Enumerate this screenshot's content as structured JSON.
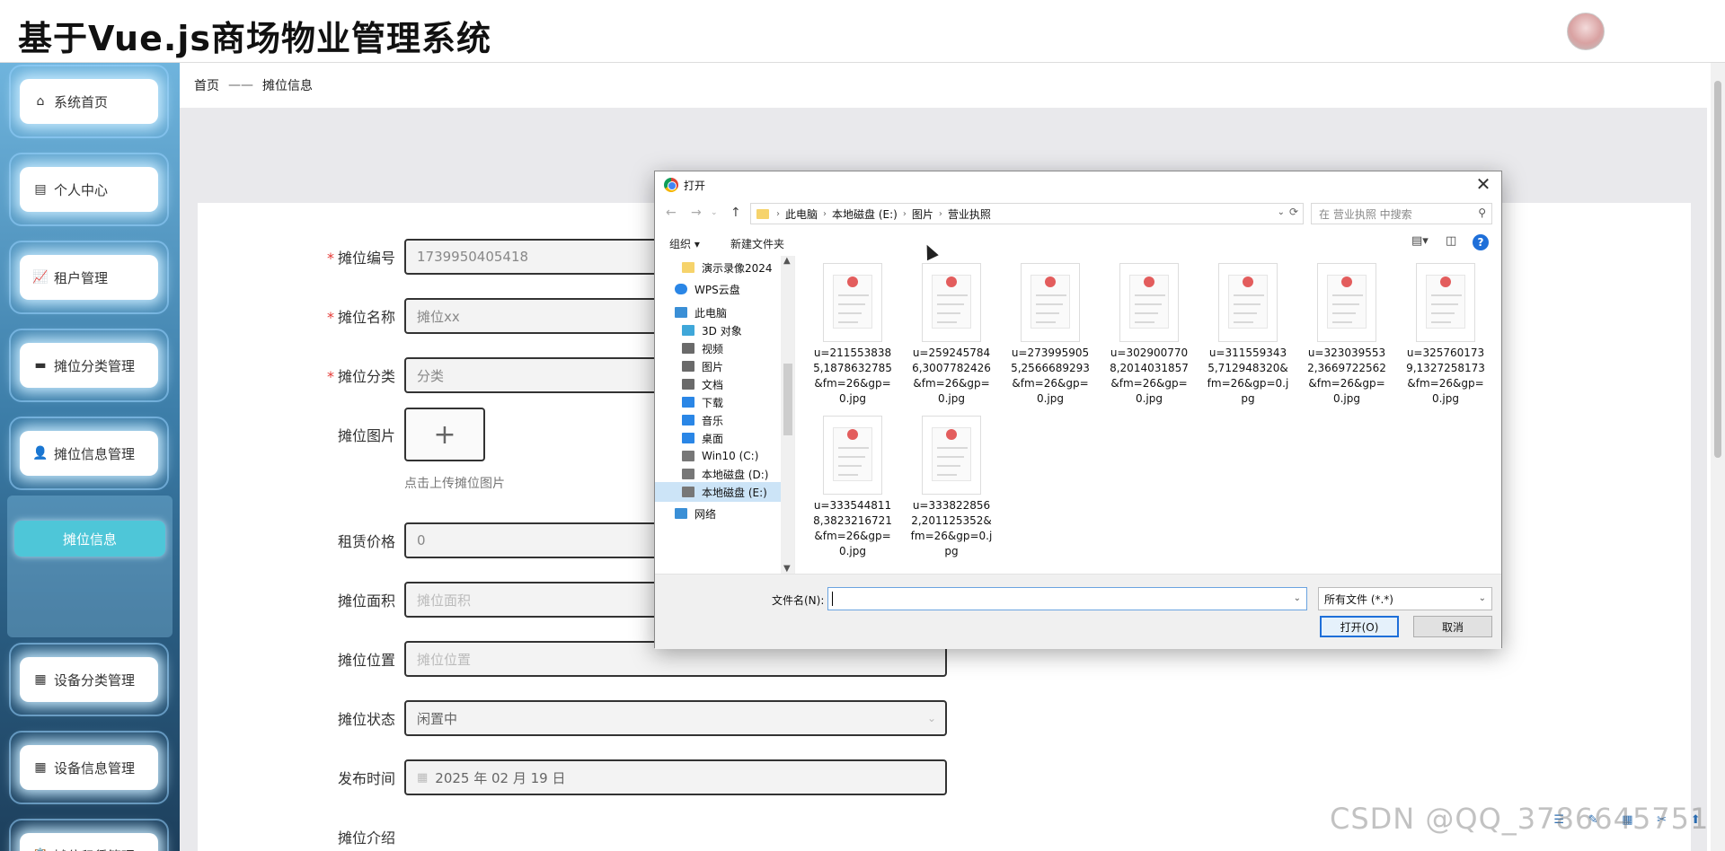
{
  "app": {
    "title": "基于Vue.js商场物业管理系统"
  },
  "sidebar": {
    "items": [
      {
        "icon": "home-icon",
        "glyph": "⌂",
        "label": "系统首页"
      },
      {
        "icon": "id-card-icon",
        "glyph": "▤",
        "label": "个人中心"
      },
      {
        "icon": "chart-icon",
        "glyph": "📈",
        "label": "租户管理"
      },
      {
        "icon": "printer-icon",
        "glyph": "▬",
        "label": "摊位分类管理"
      },
      {
        "icon": "user-icon",
        "glyph": "👤",
        "label": "摊位信息管理"
      },
      {
        "icon": "grid-icon",
        "glyph": "▦",
        "label": "设备分类管理"
      },
      {
        "icon": "grid-icon",
        "glyph": "▦",
        "label": "设备信息管理"
      },
      {
        "icon": "clipboard-icon",
        "glyph": "📋",
        "label": "摊位租赁管理"
      }
    ],
    "active_sub": "摊位信息"
  },
  "breadcrumb": {
    "home": "首页",
    "separator": "——",
    "current": "摊位信息"
  },
  "form": {
    "stall_no": {
      "label": "摊位编号",
      "value": "1739950405418",
      "required": true
    },
    "stall_name": {
      "label": "摊位名称",
      "value": "摊位xx",
      "required": true
    },
    "stall_category": {
      "label": "摊位分类",
      "value": "分类",
      "required": true
    },
    "stall_image": {
      "label": "摊位图片",
      "upload_glyph": "+",
      "hint": "点击上传摊位图片"
    },
    "rent_price": {
      "label": "租赁价格",
      "value": "0"
    },
    "stall_area": {
      "label": "摊位面积",
      "placeholder": "摊位面积"
    },
    "stall_location": {
      "label": "摊位位置",
      "placeholder": "摊位位置"
    },
    "stall_status": {
      "label": "摊位状态",
      "value": "闲置中"
    },
    "publish_time": {
      "label": "发布时间",
      "value": "2025 年 02 月 19 日"
    },
    "stall_intro": {
      "label": "摊位介绍"
    }
  },
  "dialog": {
    "title": "打开",
    "path": [
      "此电脑",
      "本地磁盘 (E:)",
      "图片",
      "营业执照"
    ],
    "search_placeholder": "在 营业执照 中搜索",
    "toolbar": {
      "organize": "组织 ▾",
      "new_folder": "新建文件夹"
    },
    "tree": [
      {
        "label": "演示录像2024",
        "icon": "folder"
      },
      {
        "label": "WPS云盘",
        "icon": "cloud"
      },
      {
        "label": "此电脑",
        "icon": "pc"
      },
      {
        "label": "3D 对象",
        "icon": "cube"
      },
      {
        "label": "视频",
        "icon": "video"
      },
      {
        "label": "图片",
        "icon": "picture"
      },
      {
        "label": "文档",
        "icon": "doc"
      },
      {
        "label": "下载",
        "icon": "download"
      },
      {
        "label": "音乐",
        "icon": "music"
      },
      {
        "label": "桌面",
        "icon": "desktop"
      },
      {
        "label": "Win10 (C:)",
        "icon": "drive"
      },
      {
        "label": "本地磁盘 (D:)",
        "icon": "drive"
      },
      {
        "label": "本地磁盘 (E:)",
        "icon": "drive",
        "selected": true
      },
      {
        "label": "网络",
        "icon": "network"
      }
    ],
    "files": [
      "u=2115538385,1878632785&fm=26&gp=0.jpg",
      "u=2592457846,3007782426&fm=26&gp=0.jpg",
      "u=2739959055,2566689293&fm=26&gp=0.jpg",
      "u=3029007708,2014031857&fm=26&gp=0.jpg",
      "u=3115593435,712948320&fm=26&gp=0.jpg",
      "u=3230395532,3669722562&fm=26&gp=0.jpg",
      "u=3257601739,1327258173&fm=26&gp=0.jpg",
      "u=3335448118,3823216721&fm=26&gp=0.jpg",
      "u=3338228562,201125352&fm=26&gp=0.jpg"
    ],
    "filename_label": "文件名(N):",
    "filename_value": "",
    "filetype": "所有文件 (*.*)",
    "open_label": "打开(O)",
    "cancel_label": "取消"
  },
  "watermark": "CSDN @QQ_3786645751"
}
